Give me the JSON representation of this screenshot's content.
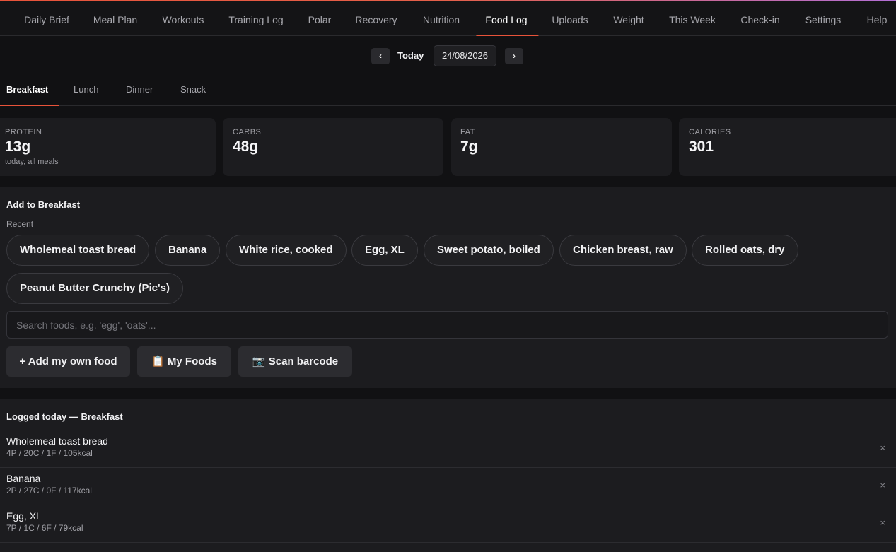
{
  "nav": {
    "items": [
      {
        "label": "Daily Brief"
      },
      {
        "label": "Meal Plan"
      },
      {
        "label": "Workouts"
      },
      {
        "label": "Training Log"
      },
      {
        "label": "Polar"
      },
      {
        "label": "Recovery"
      },
      {
        "label": "Nutrition"
      },
      {
        "label": "Food Log"
      },
      {
        "label": "Uploads"
      },
      {
        "label": "Weight"
      },
      {
        "label": "This Week"
      },
      {
        "label": "Check-in"
      },
      {
        "label": "Settings"
      },
      {
        "label": "Help"
      }
    ],
    "active": "Food Log"
  },
  "date": {
    "prev": "‹",
    "today": "Today",
    "value": "24/08/2026",
    "next": "›"
  },
  "meals": {
    "tabs": [
      {
        "label": "Breakfast"
      },
      {
        "label": "Lunch"
      },
      {
        "label": "Dinner"
      },
      {
        "label": "Snack"
      }
    ],
    "active": "Breakfast"
  },
  "stats": [
    {
      "label": "PROTEIN",
      "value": "13g",
      "note": "today, all meals"
    },
    {
      "label": "CARBS",
      "value": "48g"
    },
    {
      "label": "FAT",
      "value": "7g"
    },
    {
      "label": "CALORIES",
      "value": "301"
    }
  ],
  "add": {
    "title": "Add to Breakfast",
    "recent_label": "Recent",
    "recent": [
      "Wholemeal toast bread",
      "Banana",
      "White rice, cooked",
      "Egg, XL",
      "Sweet potato, boiled",
      "Chicken breast, raw",
      "Rolled oats, dry",
      "Peanut Butter Crunchy (Pic's)"
    ],
    "search_placeholder": "Search foods, e.g. 'egg', 'oats'...",
    "buttons": {
      "add_own": "+ Add my own food",
      "my_foods": "📋 My Foods",
      "scan": "📷 Scan barcode"
    }
  },
  "logged": {
    "title": "Logged today — Breakfast",
    "items": [
      {
        "name": "Wholemeal toast bread",
        "macros": "4P / 20C / 1F / 105kcal",
        "remove": "×"
      },
      {
        "name": "Banana",
        "macros": "2P / 27C / 0F / 117kcal",
        "remove": "×"
      },
      {
        "name": "Egg, XL",
        "macros": "7P / 1C / 6F / 79kcal",
        "remove": "×"
      }
    ]
  },
  "colors": {
    "accent": "#e8533a",
    "background": "#111113",
    "card": "#1c1c1f"
  }
}
